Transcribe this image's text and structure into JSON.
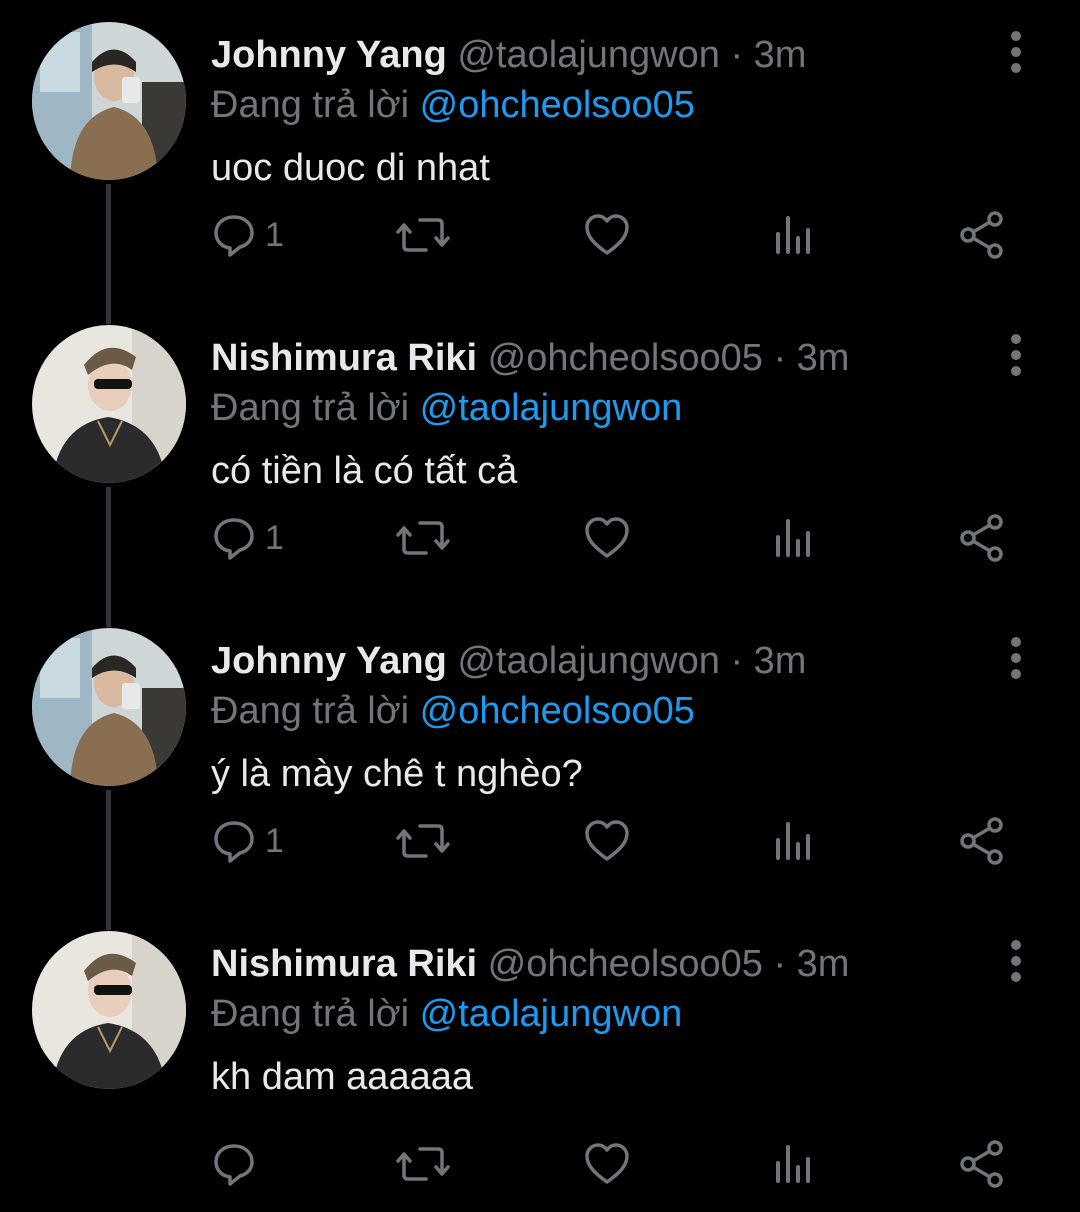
{
  "thread": [
    {
      "author": "Johnny Yang",
      "handle": "@taolajungwon",
      "separator": "·",
      "time": "3m",
      "replying_prefix": "Đang trả lời",
      "replying_to": "@ohcheolsoo05",
      "text": "uoc duoc di nhat",
      "reply_count": "1",
      "avatar": "person-selfie-photo"
    },
    {
      "author": "Nishimura Riki",
      "handle": "@ohcheolsoo05",
      "separator": "·",
      "time": "3m",
      "replying_prefix": "Đang trả lời",
      "replying_to": "@taolajungwon",
      "text": "có tiền là có tất cả",
      "reply_count": "1",
      "avatar": "person-sunglasses-photo"
    },
    {
      "author": "Johnny Yang",
      "handle": "@taolajungwon",
      "separator": "·",
      "time": "3m",
      "replying_prefix": "Đang trả lời",
      "replying_to": "@ohcheolsoo05",
      "text": "ý là mày chê t nghèo?",
      "reply_count": "1",
      "avatar": "person-selfie-photo"
    },
    {
      "author": "Nishimura Riki",
      "handle": "@ohcheolsoo05",
      "separator": "·",
      "time": "3m",
      "replying_prefix": "Đang trả lời",
      "replying_to": "@taolajungwon",
      "text": "kh dam aaaaaa",
      "reply_count": "",
      "avatar": "person-sunglasses-photo"
    }
  ],
  "icons": {
    "reply": "reply-icon",
    "retweet": "retweet-icon",
    "like": "heart-icon",
    "views": "analytics-icon",
    "share": "share-icon",
    "more": "more-vertical-icon"
  },
  "colors": {
    "background": "#000000",
    "text": "#e7e9ea",
    "muted": "#71767b",
    "link": "#1d9bf0",
    "thread_line": "#333639"
  }
}
